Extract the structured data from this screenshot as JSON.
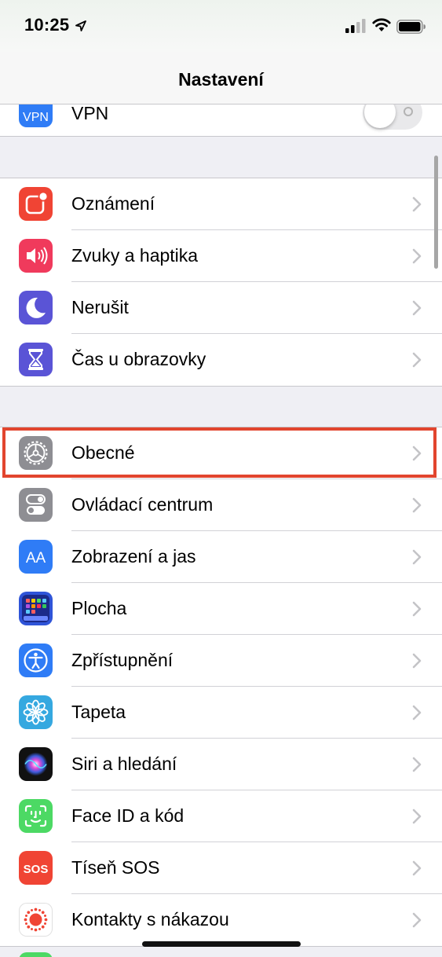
{
  "status_bar": {
    "time": "10:25"
  },
  "nav": {
    "title": "Nastavení"
  },
  "vpn": {
    "label": "VPN",
    "icon_text": "VPN",
    "toggle_on": false
  },
  "group1": [
    {
      "label": "Oznámení",
      "icon": "notifications-icon",
      "color": "#f04434"
    },
    {
      "label": "Zvuky a haptika",
      "icon": "sounds-icon",
      "color": "#f03a5c"
    },
    {
      "label": "Nerušit",
      "icon": "moon-icon",
      "color": "#5a54d6"
    },
    {
      "label": "Čas u obrazovky",
      "icon": "hourglass-icon",
      "color": "#5a54d6"
    }
  ],
  "group2": [
    {
      "label": "Obecné",
      "icon": "gear-icon",
      "color": "#8e8e93",
      "highlighted": true
    },
    {
      "label": "Ovládací centrum",
      "icon": "control-center-icon",
      "color": "#8e8e93"
    },
    {
      "label": "Zobrazení a jas",
      "icon": "display-icon",
      "color": "#2f7cf6",
      "icon_text": "AA"
    },
    {
      "label": "Plocha",
      "icon": "home-screen-icon",
      "color": "#2f54d8"
    },
    {
      "label": "Zpřístupnění",
      "icon": "accessibility-icon",
      "color": "#2f7cf6"
    },
    {
      "label": "Tapeta",
      "icon": "wallpaper-icon",
      "color": "#35a8e0"
    },
    {
      "label": "Siri a hledání",
      "icon": "siri-icon",
      "color": "#111111"
    },
    {
      "label": "Face ID a kód",
      "icon": "face-id-icon",
      "color": "#4cd964"
    },
    {
      "label": "Tíseň SOS",
      "icon": "sos-icon",
      "color": "#f04434",
      "icon_text": "SOS"
    },
    {
      "label": "Kontakty s nákazou",
      "icon": "exposure-icon",
      "color": "#ffffff"
    }
  ],
  "colors": {
    "highlight": "#e2452e",
    "chevron": "#c4c4c7"
  }
}
